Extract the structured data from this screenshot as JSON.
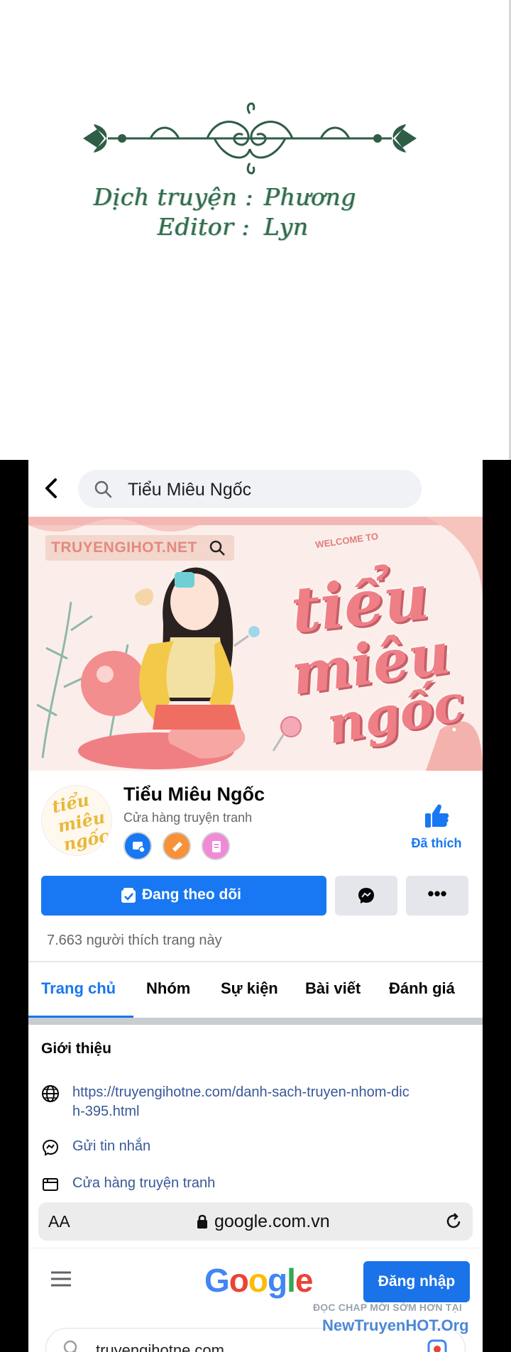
{
  "credits": {
    "translator_label": "Dịch truyện :",
    "translator_name": "Phương",
    "editor_label": "Editor :",
    "editor_name": "Lyn"
  },
  "search_bar": {
    "back_icon": "chevron-left-icon",
    "search_icon": "search-icon",
    "query": "Tiểu Miêu Ngốc"
  },
  "cover": {
    "watermark": "TRUYENGIHOT.NET",
    "welcome": "WELCOME TO",
    "script_line_1": "tiểu",
    "script_line_2": "miêu",
    "script_line_3": "ngốc"
  },
  "page": {
    "name": "Tiểu Miêu Ngốc",
    "category": "Cửa hàng truyện tranh",
    "avatar_text": [
      "tiểu",
      "miêu",
      "ngốc"
    ],
    "liked_label": "Đã thích",
    "follow_label": "Đang theo dõi",
    "more_label": "•••",
    "likes_count_text": "7.663 người thích trang này"
  },
  "tabs": [
    {
      "label": "Trang chủ",
      "active": true
    },
    {
      "label": "Nhóm",
      "active": false
    },
    {
      "label": "Sự kiện",
      "active": false
    },
    {
      "label": "Bài viết",
      "active": false
    },
    {
      "label": "Đánh giá",
      "active": false
    }
  ],
  "about": {
    "title": "Giới thiệu",
    "website": "https://truyengihotne.com/danh-sach-truyen-nhom-dich-395.html",
    "message": "Gửi tin nhắn",
    "category": "Cửa hàng truyện tranh"
  },
  "browser": {
    "text_size": "AA",
    "domain": "google.com.vn"
  },
  "google": {
    "logo_letters": [
      {
        "ch": "G",
        "color": "#4285F4"
      },
      {
        "ch": "o",
        "color": "#EA4335"
      },
      {
        "ch": "o",
        "color": "#FBBC05"
      },
      {
        "ch": "g",
        "color": "#4285F4"
      },
      {
        "ch": "l",
        "color": "#34A853"
      },
      {
        "ch": "e",
        "color": "#EA4335"
      }
    ],
    "signin_label": "Đăng nhập",
    "search_value": "truyengihotne.com"
  },
  "site_watermark": {
    "line1": "ĐỌC CHAP MỚI SỚM HƠN TẠI",
    "line2": "NewTruyenHOT.Org"
  },
  "colors": {
    "facebook_blue": "#1877f2",
    "credit_green": "#2f6b4f",
    "cover_pink": "#ef7f86"
  }
}
